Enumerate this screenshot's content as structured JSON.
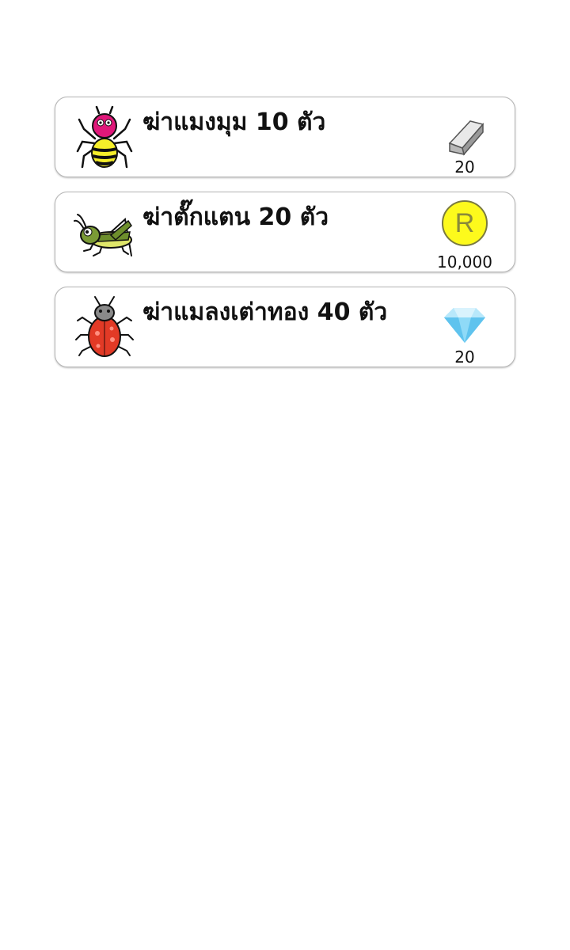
{
  "quests": [
    {
      "title": "ฆ่าแมงมุม 10 ตัว",
      "icon": "spider-icon",
      "reward_icon": "eraser-icon",
      "reward_amount": "20"
    },
    {
      "title": "ฆ่าตั๊กแตน 20 ตัว",
      "icon": "grasshopper-icon",
      "reward_icon": "coin-icon",
      "reward_symbol": "R",
      "reward_amount": "10,000"
    },
    {
      "title": "ฆ่าแมลงเต่าทอง 40 ตัว",
      "icon": "ladybug-icon",
      "reward_icon": "diamond-icon",
      "reward_amount": "20"
    }
  ],
  "colors": {
    "card_border": "#b5b5b5",
    "coin_fill": "#fdfa1c",
    "diamond": "#7fd3f5"
  }
}
